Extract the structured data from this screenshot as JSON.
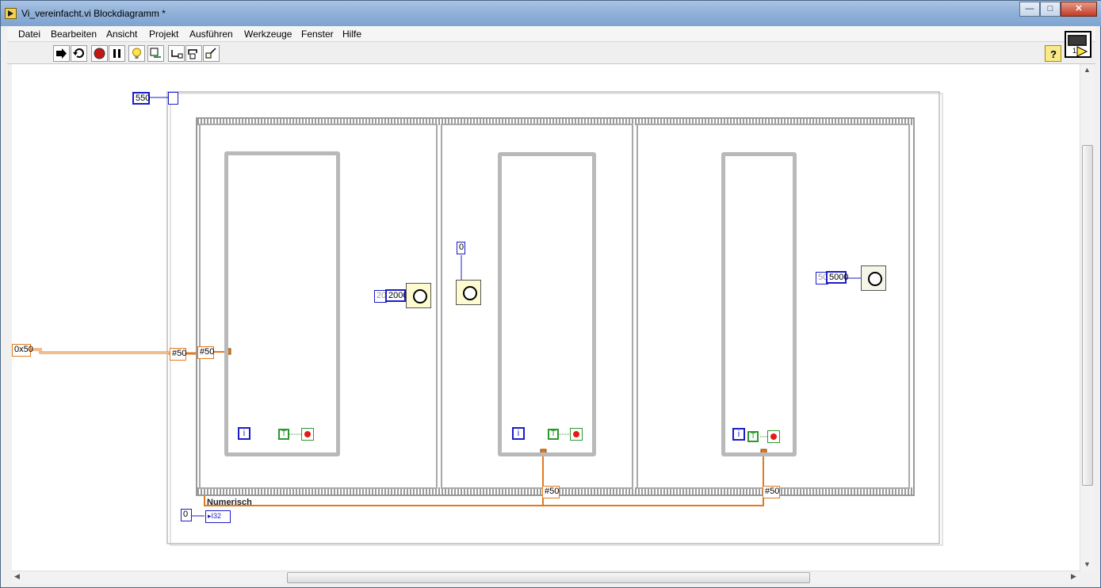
{
  "window": {
    "title": "Vi_vereinfacht.vi Blockdiagramm *",
    "controls": {
      "minimize": "—",
      "maximize": "□",
      "close": "✕"
    }
  },
  "menu": {
    "items": [
      "Datei",
      "Bearbeiten",
      "Ansicht",
      "Projekt",
      "Ausführen",
      "Werkzeuge",
      "Fenster",
      "Hilfe"
    ]
  },
  "toolbar": {
    "buttons": [
      "run-arrow-icon",
      "run-continuous-icon",
      "abort-icon",
      "pause-icon",
      "highlight-execution-icon",
      "retain-wire-values-icon",
      "step-into-icon",
      "step-over-icon",
      "step-out-icon"
    ],
    "help_icon": "question-mark-icon"
  },
  "vi_icon": {
    "label": "1"
  },
  "diagram": {
    "outer_constant": "550",
    "left_input": "0x50",
    "tunnel_outer": "#50",
    "tunnel_inner": "#50",
    "frame1": {
      "wait_prefix": "20",
      "wait_value": "2000"
    },
    "frame2": {
      "wait_value": "0"
    },
    "frame3": {
      "wait_prefix": "50",
      "wait_value": "5000"
    },
    "shift_reg_right1": "#50",
    "shift_reg_right2": "#50",
    "numeric_label": "Numerisch",
    "numeric_const": "0",
    "numeric_indicator": "▸I32",
    "iteration_terminal": "i",
    "tf_const": "T",
    "colors": {
      "wire_orange": "#e07a1e",
      "wire_blue": "#1c1cc8",
      "frame_gray": "#9a9a9a",
      "loop_gray": "#b9b9b9",
      "bool_green": "#2b9a2b"
    }
  }
}
